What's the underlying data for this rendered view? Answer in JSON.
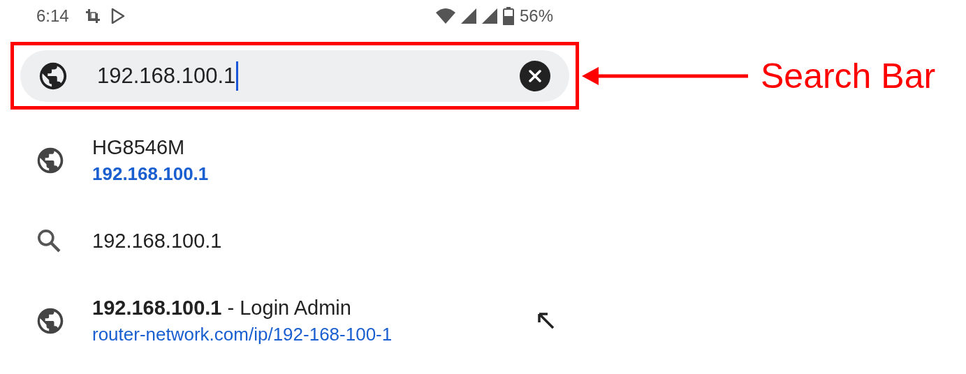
{
  "status_bar": {
    "time": "6:14",
    "battery": "56%"
  },
  "search_bar": {
    "value": "192.168.100.1",
    "focused": true
  },
  "annotation": {
    "label": "Search Bar"
  },
  "suggestions": [
    {
      "kind": "page",
      "title": "HG8546M",
      "url": "192.168.100.1",
      "url_bold": true,
      "fill_arrow": false
    },
    {
      "kind": "search",
      "title": "192.168.100.1",
      "fill_arrow": false
    },
    {
      "kind": "page",
      "title": "**192.168.100.1** - Login Admin",
      "url": "router-network.com/ip/192-168-100-1",
      "url_bold": false,
      "fill_arrow": true
    }
  ]
}
